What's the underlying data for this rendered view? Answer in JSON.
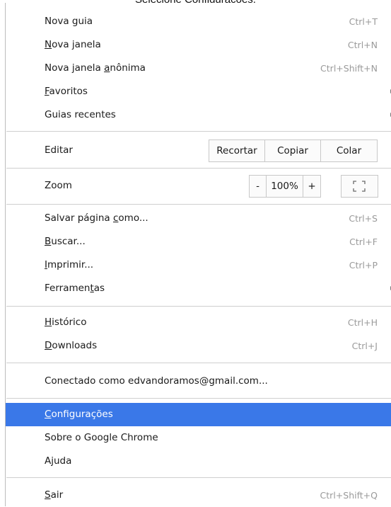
{
  "caption": "Selecione Configurações.",
  "menu": {
    "nova_guia": {
      "label": "Nova guia",
      "shortcut": "Ctrl+T"
    },
    "nova_janela": {
      "m": "N",
      "rest": "ova janela",
      "shortcut": "Ctrl+N"
    },
    "nova_janela_anonima": {
      "pre": "Nova janela ",
      "m": "a",
      "rest": "nônima",
      "shortcut": "Ctrl+Shift+N"
    },
    "favoritos": {
      "m": "F",
      "rest": "avoritos"
    },
    "guias_recentes": {
      "label": "Guias recentes"
    },
    "editar": {
      "label": "Editar",
      "recortar": "Recortar",
      "copiar": "Copiar",
      "colar": "Colar"
    },
    "zoom": {
      "label": "Zoom",
      "minus": "-",
      "value": "100%",
      "plus": "+"
    },
    "salvar": {
      "pre": "Salvar página ",
      "m": "c",
      "rest": "omo...",
      "shortcut": "Ctrl+S"
    },
    "buscar": {
      "m": "B",
      "rest": "uscar...",
      "shortcut": "Ctrl+F"
    },
    "imprimir": {
      "m": "I",
      "rest": "mprimir...",
      "shortcut": "Ctrl+P"
    },
    "ferramentas": {
      "pre": "Ferramen",
      "m": "t",
      "rest": "as"
    },
    "historico": {
      "m": "H",
      "rest": "istórico",
      "shortcut": "Ctrl+H"
    },
    "downloads": {
      "m": "D",
      "rest": "ownloads",
      "shortcut": "Ctrl+J"
    },
    "conectado": {
      "label": "Conectado como edvandoramos@gmail.com..."
    },
    "configuracoes": {
      "m": "C",
      "rest": "onfigurações"
    },
    "sobre": {
      "label": "Sobre o Google Chrome"
    },
    "ajuda": {
      "label": "Ajuda"
    },
    "sair": {
      "m": "S",
      "rest": "air",
      "shortcut": "Ctrl+Shift+Q"
    }
  },
  "colors": {
    "highlight": "#3a78e8",
    "shortcut": "#9a9a9a",
    "separator": "#cfcfcf"
  }
}
